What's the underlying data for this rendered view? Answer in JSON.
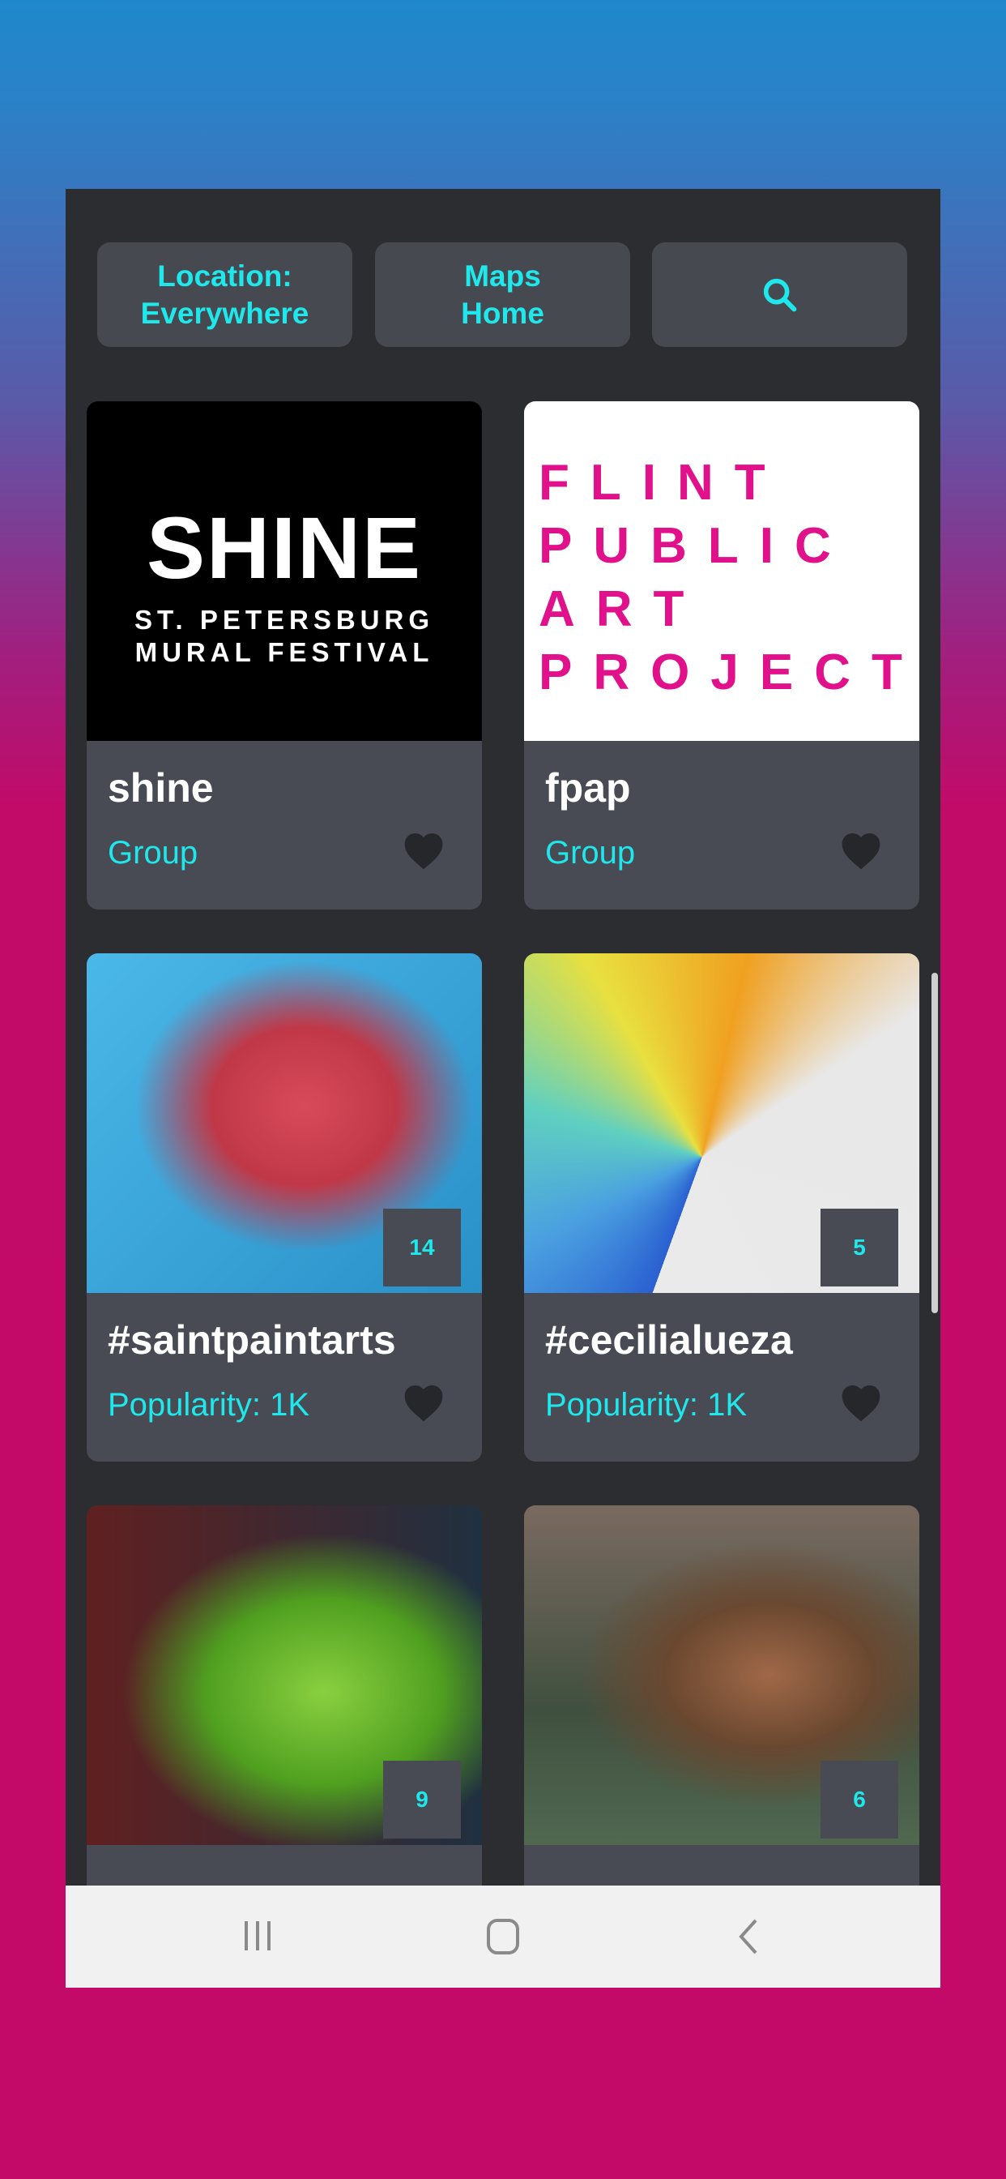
{
  "toolbar": {
    "location_label": "Location:",
    "location_value": "Everywhere",
    "maps_line1": "Maps",
    "maps_line2": "Home",
    "search_icon": "search-icon"
  },
  "cards": [
    {
      "title": "shine",
      "subtitle": "Group",
      "logo_text": "SHINE ST. PETERSBURG MURAL FESTIVAL"
    },
    {
      "title": "fpap",
      "subtitle": "Group",
      "logo_text": "FLINT PUBLIC ART PROJECT"
    },
    {
      "title": "#saintpaintarts",
      "subtitle": "Popularity: 1K",
      "count": "14"
    },
    {
      "title": "#cecilialueza",
      "subtitle": "Popularity: 1K",
      "count": "5"
    },
    {
      "count": "9"
    },
    {
      "count": "6"
    }
  ],
  "colors": {
    "accent": "#1ee8ec",
    "card": "#484b54",
    "panel": "#2b2d31"
  }
}
